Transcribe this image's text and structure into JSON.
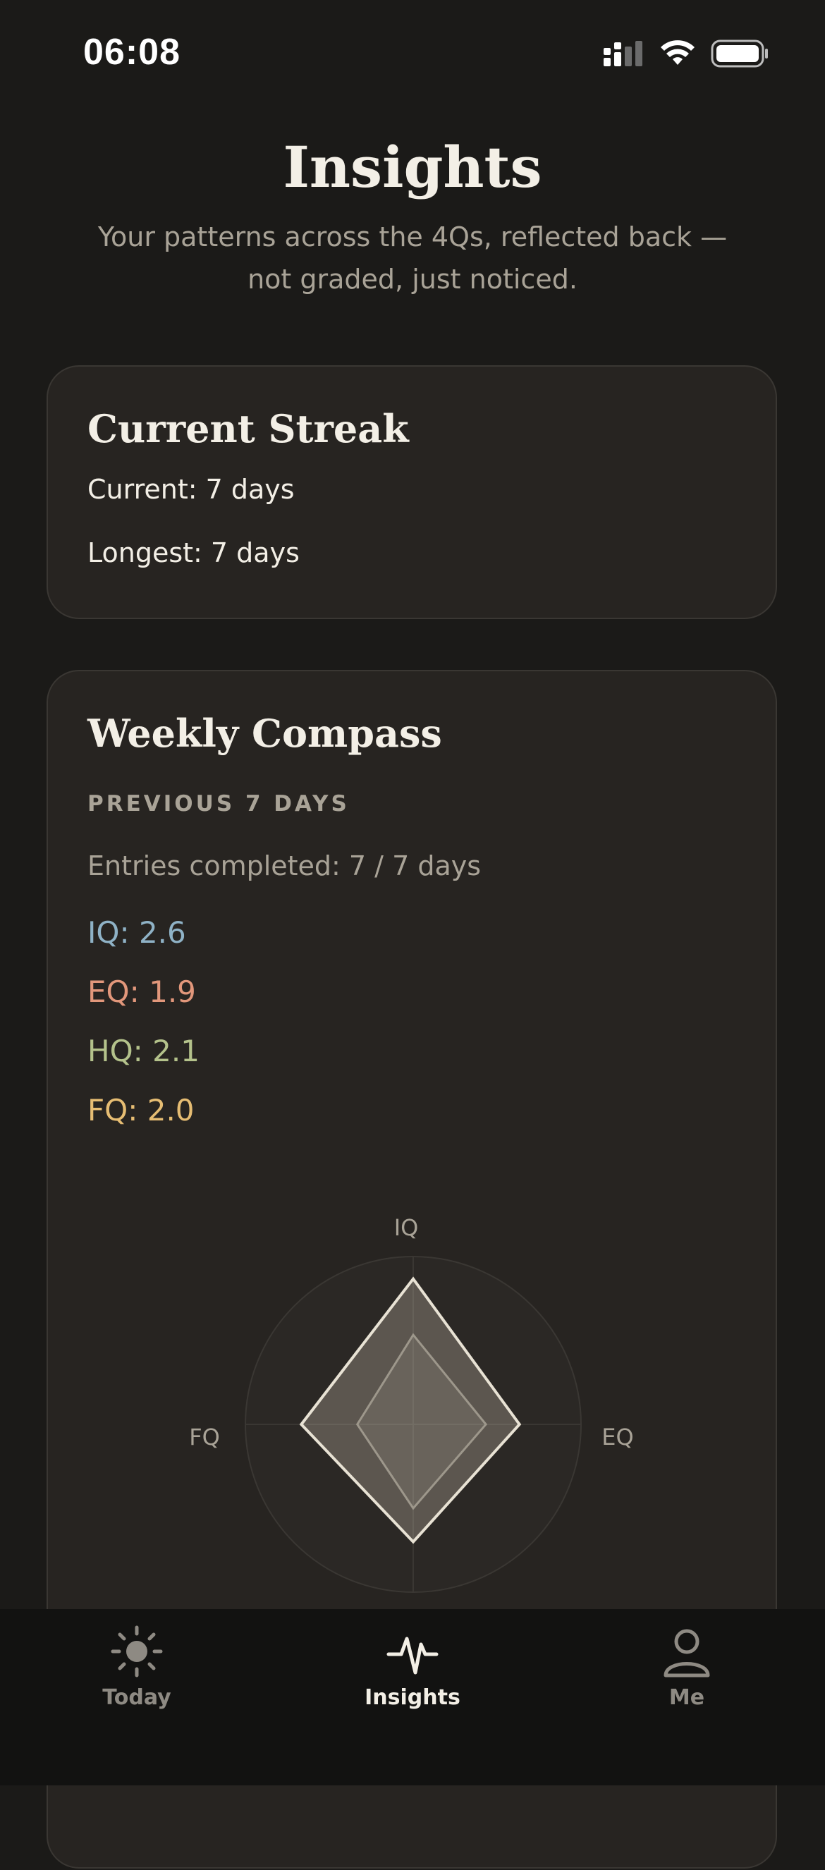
{
  "status_bar": {
    "time": "06:08"
  },
  "header": {
    "title": "Insights",
    "subtitle": "Your patterns across the 4Qs, reflected back — not graded, just noticed."
  },
  "streak_card": {
    "title": "Current Streak",
    "current": "Current: 7 days",
    "longest": "Longest: 7 days"
  },
  "compass_card": {
    "title": "Weekly Compass",
    "period_label": "PREVIOUS 7 DAYS",
    "entries": "Entries completed: 7 / 7 days",
    "scores": [
      {
        "text": "IQ: 2.6",
        "color": "#8fb2c6"
      },
      {
        "text": "EQ: 1.9",
        "color": "#e2977b"
      },
      {
        "text": "HQ: 2.1",
        "color": "#b4c28b"
      },
      {
        "text": "FQ: 2.0",
        "color": "#e6bd73"
      }
    ],
    "radar_axes": {
      "top": "IQ",
      "right": "EQ",
      "left": "FQ"
    }
  },
  "chart_data": {
    "type": "radar",
    "axes": [
      "IQ",
      "EQ",
      "HQ",
      "FQ"
    ],
    "series": [
      {
        "values": [
          2.6,
          1.9,
          2.1,
          2.0
        ]
      },
      {
        "values": [
          1.6,
          1.3,
          1.5,
          1.0
        ]
      }
    ],
    "range": [
      0,
      3
    ]
  },
  "tab_bar": {
    "items": [
      {
        "label": "Today",
        "icon": "sun-icon",
        "active": false
      },
      {
        "label": "Insights",
        "icon": "pulse-icon",
        "active": true
      },
      {
        "label": "Me",
        "icon": "person-icon",
        "active": false
      }
    ]
  },
  "colors": {
    "background": "#1b1a18",
    "card": "#272421",
    "text": "#f3efe6",
    "muted": "#a9a397"
  }
}
